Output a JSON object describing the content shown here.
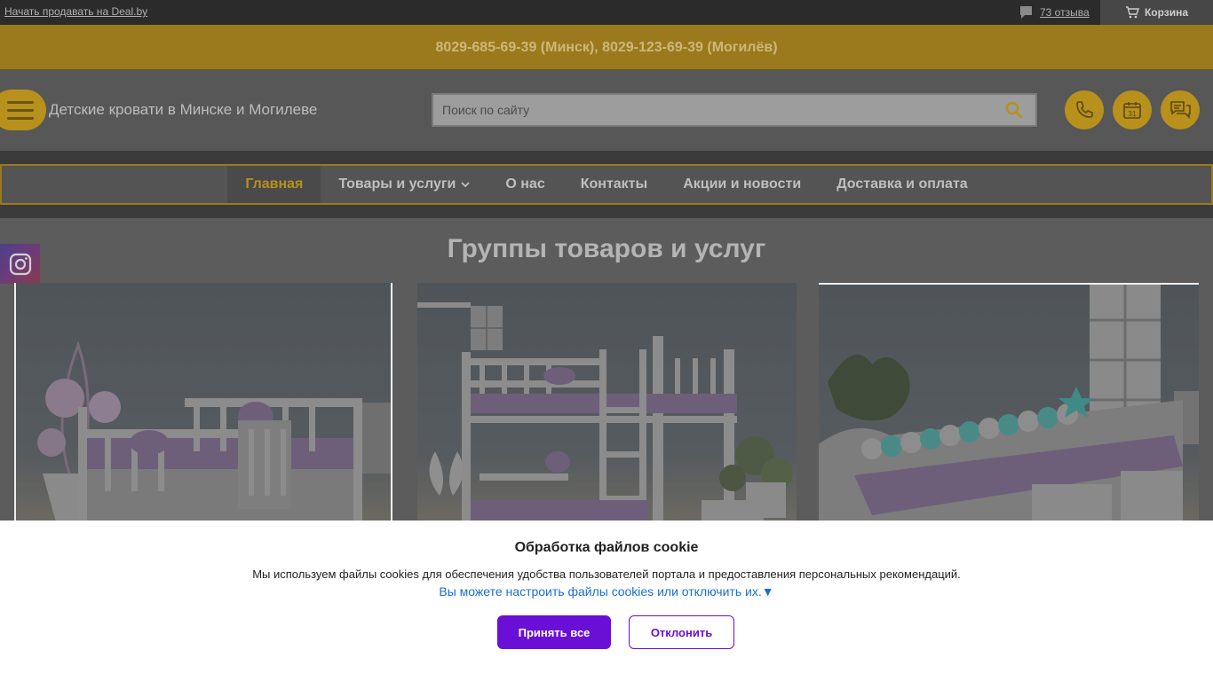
{
  "topbar": {
    "sell_link": "Начать продавать на Deal.by",
    "reviews": "73 отзыва",
    "cart": "Корзина"
  },
  "phones": "8029-685-69-39 (Минск), 8029-123-69-39 (Могилёв)",
  "header": {
    "site_title": "Детские кровати в Минске и Могилеве",
    "search_placeholder": "Поиск по сайту",
    "icons": [
      "phone-icon",
      "calendar-icon",
      "chat-icon"
    ],
    "calendar_day": "31"
  },
  "nav": {
    "items": [
      {
        "label": "Главная",
        "active": true
      },
      {
        "label": "Товары и услуги",
        "dropdown": true
      },
      {
        "label": "О нас"
      },
      {
        "label": "Контакты"
      },
      {
        "label": "Акции и новости"
      },
      {
        "label": "Доставка и оплата"
      }
    ]
  },
  "main": {
    "title": "Группы товаров и услуг",
    "social": "instagram-icon"
  },
  "cookie": {
    "title": "Обработка файлов cookie",
    "description": "Мы используем файлы cookies для обеспечения удобства пользователей портала и предоставления персональных рекомендаций.",
    "settings_link": "Вы можете настроить файлы cookies или отключить их.▼",
    "accept_label": "Принять все",
    "decline_label": "Отклонить"
  },
  "colors": {
    "accent": "#b8901c",
    "cookie_button": "#6a0fd6",
    "link": "#1a6fd0"
  }
}
